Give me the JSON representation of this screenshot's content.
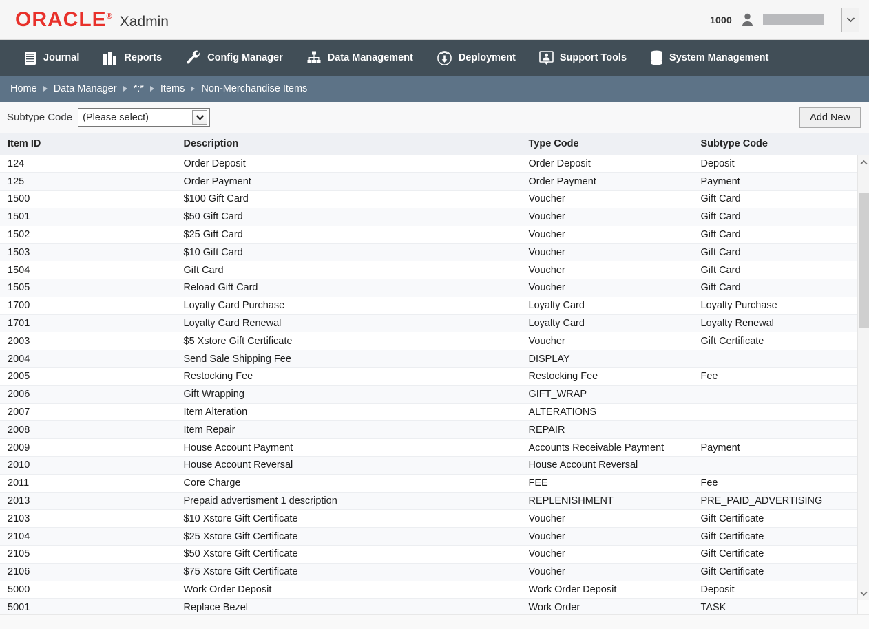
{
  "header": {
    "logo_text": "ORACLE",
    "logo_reg": "®",
    "app_name": "Xadmin",
    "store_number": "1000",
    "user_icon": "user-icon",
    "user_name": "",
    "dropdown_icon": "chevron-down-icon"
  },
  "nav": {
    "items": [
      {
        "label": "Journal",
        "icon": "journal-book-icon"
      },
      {
        "label": "Reports",
        "icon": "bar-chart-icon"
      },
      {
        "label": "Config Manager",
        "icon": "wrench-icon"
      },
      {
        "label": "Data Management",
        "icon": "org-chart-icon"
      },
      {
        "label": "Deployment",
        "icon": "cloud-download-icon"
      },
      {
        "label": "Support Tools",
        "icon": "person-speech-bubble-icon"
      },
      {
        "label": "System Management",
        "icon": "database-icon"
      }
    ]
  },
  "breadcrumb": {
    "items": [
      "Home",
      "Data Manager",
      "*:*",
      "Items",
      "Non-Merchandise Items"
    ],
    "separator_icon": "triangle-right-icon"
  },
  "filter": {
    "label": "Subtype Code",
    "select_value": "(Please select)",
    "select_arrow_icon": "chevron-down-icon",
    "add_new_label": "Add New"
  },
  "table": {
    "columns": [
      "Item ID",
      "Description",
      "Type Code",
      "Subtype Code"
    ],
    "rows": [
      [
        "124",
        "Order Deposit",
        "Order Deposit",
        "Deposit"
      ],
      [
        "125",
        "Order Payment",
        "Order Payment",
        "Payment"
      ],
      [
        "1500",
        "$100 Gift Card",
        "Voucher",
        "Gift Card"
      ],
      [
        "1501",
        "$50 Gift Card",
        "Voucher",
        "Gift Card"
      ],
      [
        "1502",
        "$25 Gift Card",
        "Voucher",
        "Gift Card"
      ],
      [
        "1503",
        "$10 Gift Card",
        "Voucher",
        "Gift Card"
      ],
      [
        "1504",
        "Gift Card",
        "Voucher",
        "Gift Card"
      ],
      [
        "1505",
        "Reload Gift Card",
        "Voucher",
        "Gift Card"
      ],
      [
        "1700",
        "Loyalty Card Purchase",
        "Loyalty Card",
        "Loyalty Purchase"
      ],
      [
        "1701",
        "Loyalty Card Renewal",
        "Loyalty Card",
        "Loyalty Renewal"
      ],
      [
        "2003",
        "$5 Xstore Gift Certificate",
        "Voucher",
        "Gift Certificate"
      ],
      [
        "2004",
        "Send Sale Shipping Fee",
        "DISPLAY",
        ""
      ],
      [
        "2005",
        "Restocking Fee",
        "Restocking Fee",
        "Fee"
      ],
      [
        "2006",
        "Gift Wrapping",
        "GIFT_WRAP",
        ""
      ],
      [
        "2007",
        "Item Alteration",
        "ALTERATIONS",
        ""
      ],
      [
        "2008",
        "Item Repair",
        "REPAIR",
        ""
      ],
      [
        "2009",
        "House Account Payment",
        "Accounts Receivable Payment",
        "Payment"
      ],
      [
        "2010",
        "House Account Reversal",
        "House Account Reversal",
        ""
      ],
      [
        "2011",
        "Core Charge",
        "FEE",
        "Fee"
      ],
      [
        "2013",
        "Prepaid advertisment 1 description",
        "REPLENISHMENT",
        "PRE_PAID_ADVERTISING"
      ],
      [
        "2103",
        "$10 Xstore Gift Certificate",
        "Voucher",
        "Gift Certificate"
      ],
      [
        "2104",
        "$25 Xstore Gift Certificate",
        "Voucher",
        "Gift Certificate"
      ],
      [
        "2105",
        "$50 Xstore Gift Certificate",
        "Voucher",
        "Gift Certificate"
      ],
      [
        "2106",
        "$75 Xstore Gift Certificate",
        "Voucher",
        "Gift Certificate"
      ],
      [
        "5000",
        "Work Order Deposit",
        "Work Order Deposit",
        "Deposit"
      ],
      [
        "5001",
        "Replace Bezel",
        "Work Order",
        "TASK"
      ]
    ]
  },
  "scrollbar": {
    "up_icon": "chevron-up-icon",
    "down_icon": "chevron-down-icon"
  },
  "colors": {
    "oracle_red": "#e8312b",
    "nav_bg": "#414e57",
    "breadcrumb_bg": "#5d7387",
    "header_row_bg": "#eef0f4"
  }
}
